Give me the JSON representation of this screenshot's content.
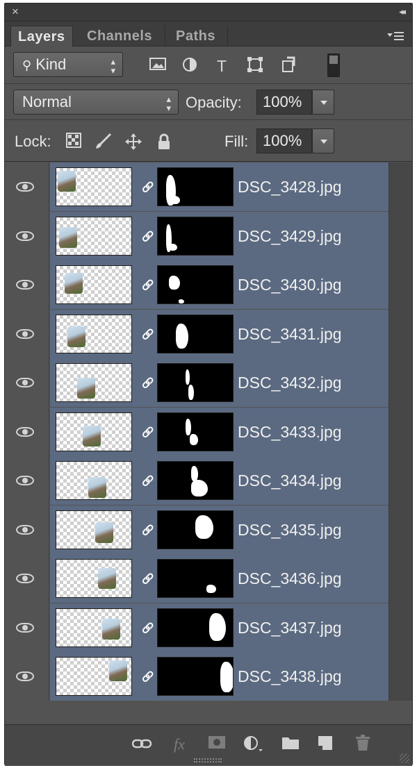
{
  "window": {
    "close_glyph": "×",
    "collapse_glyph": "◂◂"
  },
  "tabs": [
    {
      "label": "Layers",
      "active": true
    },
    {
      "label": "Channels",
      "active": false
    },
    {
      "label": "Paths",
      "active": false
    }
  ],
  "filter": {
    "kind_label": "Kind",
    "icons": [
      "image-filter-icon",
      "adjustment-filter-icon",
      "type-filter-icon",
      "shape-filter-icon",
      "smart-object-filter-icon"
    ]
  },
  "blend": {
    "mode": "Normal",
    "opacity_label": "Opacity:",
    "opacity_value": "100%"
  },
  "lock": {
    "label": "Lock:",
    "fill_label": "Fill:",
    "fill_value": "100%"
  },
  "layers": [
    {
      "name": "DSC_3428.jpg",
      "visible": true,
      "selected": true
    },
    {
      "name": "DSC_3429.jpg",
      "visible": true,
      "selected": true
    },
    {
      "name": "DSC_3430.jpg",
      "visible": true,
      "selected": true
    },
    {
      "name": "DSC_3431.jpg",
      "visible": true,
      "selected": true
    },
    {
      "name": "DSC_3432.jpg",
      "visible": true,
      "selected": true
    },
    {
      "name": "DSC_3433.jpg",
      "visible": true,
      "selected": true
    },
    {
      "name": "DSC_3434.jpg",
      "visible": true,
      "selected": true
    },
    {
      "name": "DSC_3435.jpg",
      "visible": true,
      "selected": true
    },
    {
      "name": "DSC_3436.jpg",
      "visible": true,
      "selected": true
    },
    {
      "name": "DSC_3437.jpg",
      "visible": true,
      "selected": true
    },
    {
      "name": "DSC_3438.jpg",
      "visible": true,
      "selected": true
    }
  ],
  "footer": {
    "fx_label": "fx"
  },
  "colors": {
    "panel_bg": "#535353",
    "selected_row": "#5b6a81",
    "tab_bar": "#3d3d3d"
  }
}
